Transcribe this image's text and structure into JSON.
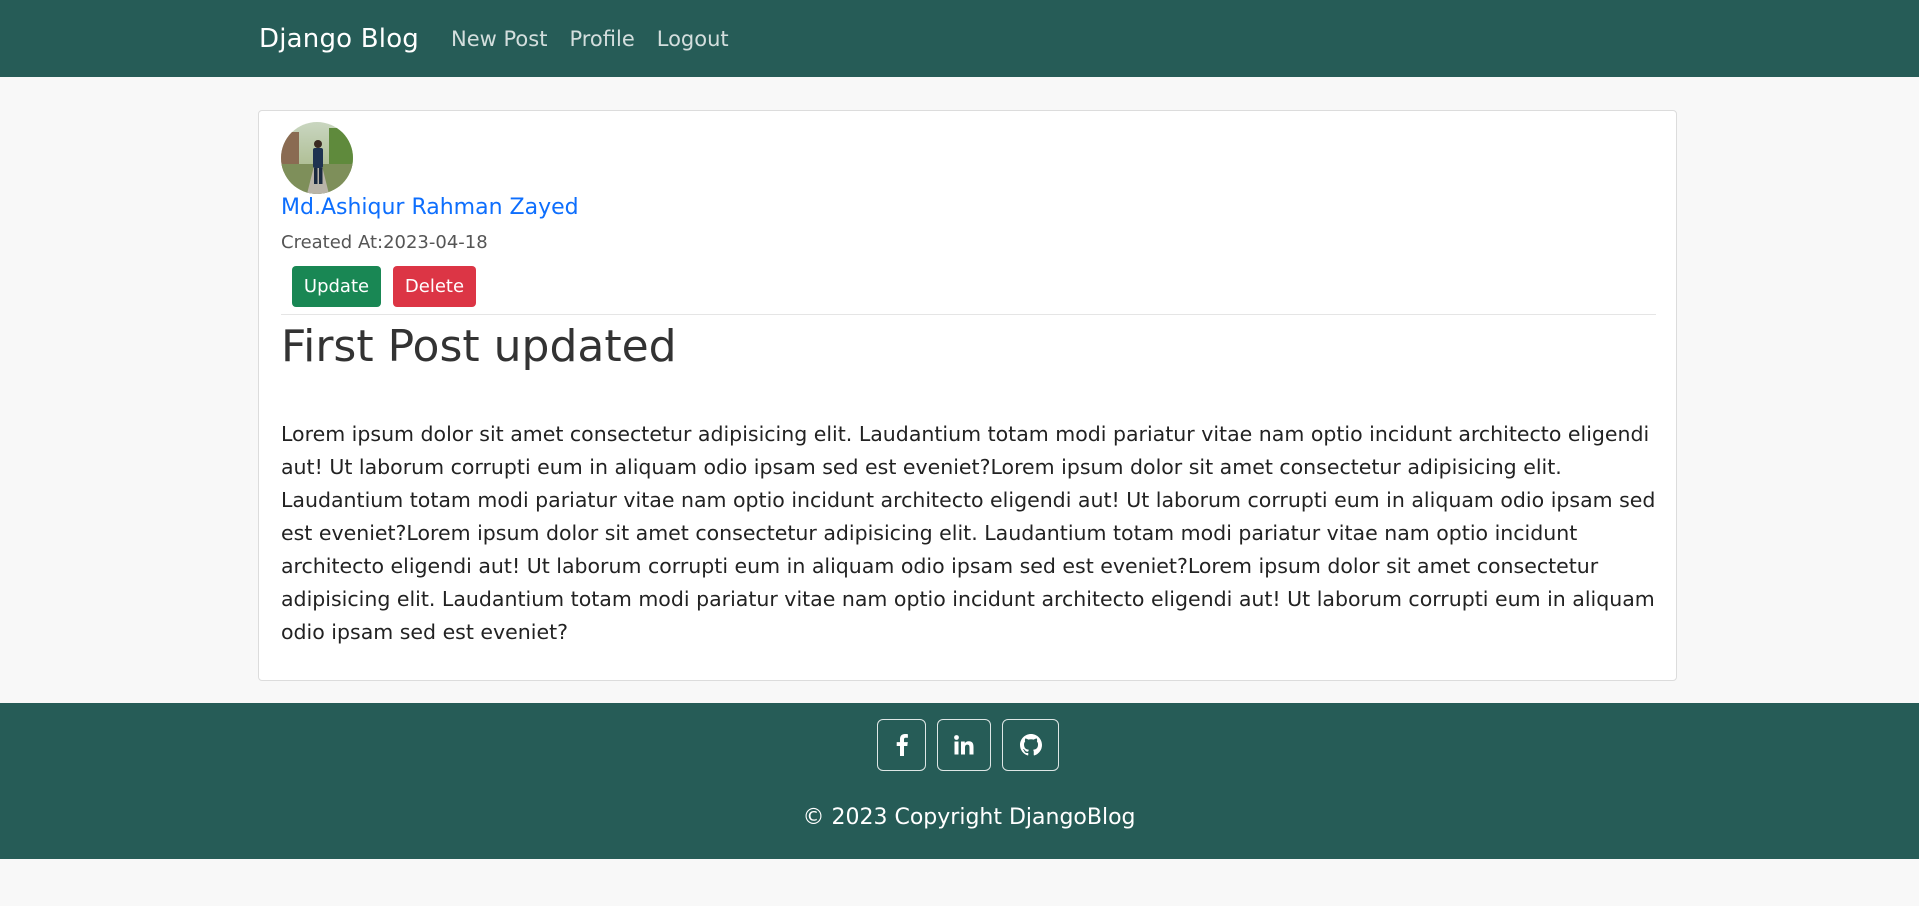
{
  "navbar": {
    "brand": "Django Blog",
    "links": [
      "New Post",
      "Profile",
      "Logout"
    ]
  },
  "post": {
    "author": "Md.Ashiqur Rahman Zayed",
    "created_at": "Created At:2023-04-18",
    "update_label": "Update",
    "delete_label": "Delete",
    "title": "First Post updated",
    "body": "Lorem ipsum dolor sit amet consectetur adipisicing elit. Laudantium totam modi pariatur vitae nam optio incidunt architecto eligendi aut! Ut laborum corrupti eum in aliquam odio ipsam sed est eveniet?Lorem ipsum dolor sit amet consectetur adipisicing elit. Laudantium totam modi pariatur vitae nam optio incidunt architecto eligendi aut! Ut laborum corrupti eum in aliquam odio ipsam sed est eveniet?Lorem ipsum dolor sit amet consectetur adipisicing elit. Laudantium totam modi pariatur vitae nam optio incidunt architecto eligendi aut! Ut laborum corrupti eum in aliquam odio ipsam sed est eveniet?Lorem ipsum dolor sit amet consectetur adipisicing elit. Laudantium totam modi pariatur vitae nam optio incidunt architecto eligendi aut! Ut laborum corrupti eum in aliquam odio ipsam sed est eveniet?"
  },
  "footer": {
    "social_icons": [
      "facebook-icon",
      "linkedin-icon",
      "github-icon"
    ],
    "copyright": "© 2023 Copyright DjangoBlog"
  },
  "colors": {
    "navbar_bg": "#265c57",
    "update_button": "#198754",
    "delete_button": "#dc3545",
    "author_link": "#0d6efd"
  }
}
